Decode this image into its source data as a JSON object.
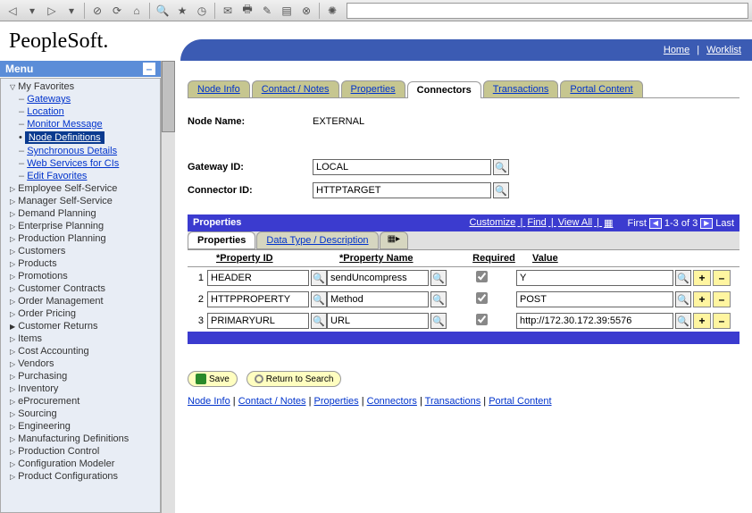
{
  "header": {
    "logo": "PeopleSoft.",
    "links": {
      "home": "Home",
      "worklist": "Worklist"
    }
  },
  "menu": {
    "title": "Menu",
    "favorites": "My Favorites",
    "fav_items": [
      {
        "label": "Gateways"
      },
      {
        "label": "Location"
      },
      {
        "label": "Monitor Message"
      },
      {
        "label": "Node Definitions",
        "selected": true
      },
      {
        "label": "Synchronous Details"
      },
      {
        "label": "Web Services for CIs"
      },
      {
        "label": "Edit Favorites"
      }
    ],
    "items": [
      "Employee Self-Service",
      "Manager Self-Service",
      "Demand Planning",
      "Enterprise Planning",
      "Production Planning",
      "Customers",
      "Products",
      "Promotions",
      "Customer Contracts",
      "Order Management",
      "Order Pricing"
    ],
    "cust_returns": "Customer Returns",
    "items2": [
      "Items",
      "Cost Accounting",
      "Vendors",
      "Purchasing",
      "Inventory",
      "eProcurement",
      "Sourcing",
      "Engineering",
      "Manufacturing Definitions",
      "Production Control",
      "Configuration Modeler",
      "Product Configurations"
    ]
  },
  "tabs": [
    "Node Info",
    "Contact / Notes",
    "Properties",
    "Connectors",
    "Transactions",
    "Portal Content"
  ],
  "active_tab": "Connectors",
  "form": {
    "node_name_label": "Node Name:",
    "node_name": "EXTERNAL",
    "gateway_label": "Gateway ID:",
    "gateway": "LOCAL",
    "connector_label": "Connector ID:",
    "connector": "HTTPTARGET"
  },
  "grid": {
    "title": "Properties",
    "links": {
      "customize": "Customize",
      "find": "Find",
      "viewall": "View All"
    },
    "nav": {
      "first": "First",
      "range": "1-3 of 3",
      "last": "Last"
    },
    "subtabs": {
      "properties": "Properties",
      "datatype": "Data Type / Description"
    },
    "cols": {
      "id": "*Property ID",
      "name": "*Property Name",
      "required": "Required",
      "value": "Value"
    },
    "rows": [
      {
        "n": "1",
        "id": "HEADER",
        "name": "sendUncompress",
        "required": true,
        "value": "Y"
      },
      {
        "n": "2",
        "id": "HTTPPROPERTY",
        "name": "Method",
        "required": true,
        "value": "POST"
      },
      {
        "n": "3",
        "id": "PRIMARYURL",
        "name": "URL",
        "required": true,
        "value": "http://172.30.172.39:5576"
      }
    ]
  },
  "buttons": {
    "save": "Save",
    "return": "Return to Search"
  },
  "bottom_links": [
    "Node Info",
    "Contact / Notes",
    "Properties",
    "Connectors",
    "Transactions",
    "Portal Content"
  ]
}
